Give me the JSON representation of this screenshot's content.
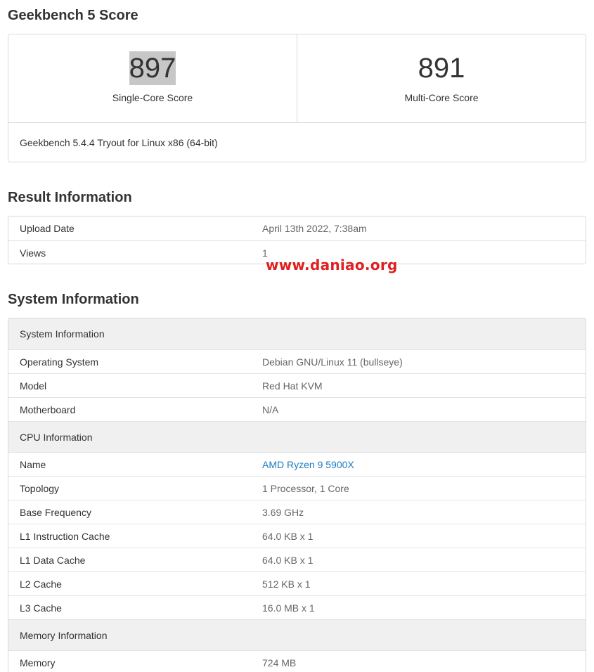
{
  "score_section": {
    "title": "Geekbench 5 Score",
    "single_core": {
      "value": "897",
      "label": "Single-Core Score"
    },
    "multi_core": {
      "value": "891",
      "label": "Multi-Core Score"
    },
    "version": "Geekbench 5.4.4 Tryout for Linux x86 (64-bit)"
  },
  "result_section": {
    "title": "Result Information",
    "rows": [
      {
        "key": "Upload Date",
        "value": "April 13th 2022, 7:38am"
      },
      {
        "key": "Views",
        "value": "1"
      }
    ]
  },
  "watermark": "www.daniao.org",
  "system_section": {
    "title": "System Information",
    "groups": [
      {
        "heading": "System Information",
        "rows": [
          {
            "key": "Operating System",
            "value": "Debian GNU/Linux 11 (bullseye)"
          },
          {
            "key": "Model",
            "value": "Red Hat KVM"
          },
          {
            "key": "Motherboard",
            "value": "N/A"
          }
        ]
      },
      {
        "heading": "CPU Information",
        "rows": [
          {
            "key": "Name",
            "value": "AMD Ryzen 9 5900X"
          },
          {
            "key": "Topology",
            "value": "1 Processor, 1 Core"
          },
          {
            "key": "Base Frequency",
            "value": "3.69 GHz"
          },
          {
            "key": "L1 Instruction Cache",
            "value": "64.0 KB x 1"
          },
          {
            "key": "L1 Data Cache",
            "value": "64.0 KB x 1"
          },
          {
            "key": "L2 Cache",
            "value": "512 KB x 1"
          },
          {
            "key": "L3 Cache",
            "value": "16.0 MB x 1"
          }
        ]
      },
      {
        "heading": "Memory Information",
        "rows": [
          {
            "key": "Memory",
            "value": "724 MB"
          }
        ]
      }
    ]
  },
  "colors": {
    "link": "#1a7cc1",
    "watermark": "#e02020",
    "group_header_bg": "#f0f0f0",
    "score_highlight": "#c7c7c7"
  }
}
